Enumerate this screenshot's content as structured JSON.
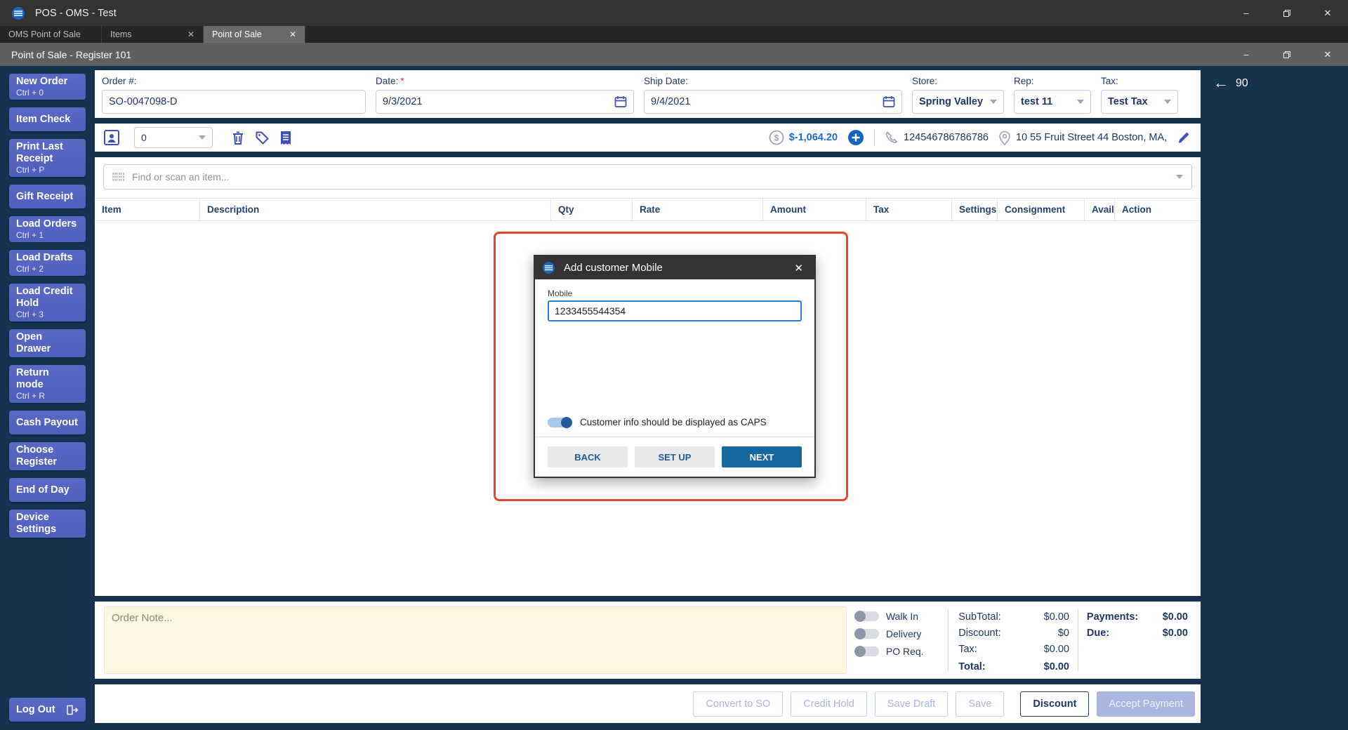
{
  "window": {
    "title": "POS - OMS - Test",
    "register_title": "Point of Sale - Register 101",
    "minimize": "–",
    "close": "✕"
  },
  "tabs": [
    {
      "label": "OMS Point of Sale"
    },
    {
      "label": "Items",
      "close": "✕"
    },
    {
      "label": "Point of Sale",
      "close": "✕"
    }
  ],
  "sidebar": {
    "items": [
      {
        "label": "New Order",
        "shortcut": "Ctrl + 0"
      },
      {
        "label": "Item Check"
      },
      {
        "label": "Print Last Receipt",
        "shortcut": "Ctrl + P"
      },
      {
        "label": "Gift Receipt"
      },
      {
        "label": "Load Orders",
        "shortcut": "Ctrl + 1"
      },
      {
        "label": "Load Drafts",
        "shortcut": "Ctrl + 2"
      },
      {
        "label": "Load Credit Hold",
        "shortcut": "Ctrl + 3"
      },
      {
        "label": "Open Drawer"
      },
      {
        "label": "Return mode",
        "shortcut": "Ctrl + R"
      },
      {
        "label": "Cash Payout"
      },
      {
        "label": "Choose Register"
      },
      {
        "label": "End of Day"
      },
      {
        "label": "Device Settings"
      }
    ],
    "logout_label": "Log Out"
  },
  "order_form": {
    "order_label": "Order #:",
    "order_value": "SO-0047098-D",
    "date_label": "Date:",
    "required_mark": "*",
    "date_value": "9/3/2021",
    "ship_date_label": "Ship Date:",
    "ship_date_value": "9/4/2021",
    "store_label": "Store:",
    "store_value": "Spring Valley",
    "rep_label": "Rep:",
    "rep_value": "test 11",
    "tax_label": "Tax:",
    "tax_value": "Test Tax"
  },
  "customer_bar": {
    "count_value": "0",
    "balance": "$-1,064.20",
    "phone": "124546786786786",
    "address": "10 55 Fruit Street 44 Boston, MA,..."
  },
  "back_nav": {
    "arrow": "←",
    "count": "90"
  },
  "search": {
    "placeholder": "Find or scan an item..."
  },
  "items_table": {
    "columns": [
      "Item",
      "Description",
      "Qty",
      "Rate",
      "Amount",
      "Tax",
      "Settings",
      "Consignment",
      "Avail",
      "Action"
    ]
  },
  "modal": {
    "title": "Add customer Mobile",
    "close": "✕",
    "field_label": "Mobile",
    "field_value": "1233455544354",
    "toggle_label": "Customer info should be displayed as CAPS",
    "back_label": "BACK",
    "setup_label": "SET UP",
    "next_label": "NEXT"
  },
  "footer": {
    "note_placeholder": "Order Note...",
    "toggles": [
      {
        "label": "Walk In",
        "state": "off"
      },
      {
        "label": "Delivery",
        "state": "off"
      },
      {
        "label": "PO Req.",
        "state": "off"
      }
    ],
    "totals": [
      {
        "label": "SubTotal:",
        "value": "$0.00"
      },
      {
        "label": "Discount:",
        "value": "$0"
      },
      {
        "label": "Tax:",
        "value": "$0.00"
      },
      {
        "label": "Total:",
        "value": "$0.00"
      }
    ],
    "payments": [
      {
        "label": "Payments:",
        "value": "$0.00"
      },
      {
        "label": "Due:",
        "value": "$0.00"
      }
    ],
    "buttons": [
      {
        "label": "Convert to SO"
      },
      {
        "label": "Credit Hold"
      },
      {
        "label": "Save Draft"
      },
      {
        "label": "Save"
      },
      {
        "label": "Discount"
      },
      {
        "label": "Accept Payment"
      }
    ]
  },
  "colors": {
    "app_background": "#16324f",
    "sidebar_button": "#5565c0",
    "accent_indigo": "#3f51b5",
    "link_blue": "#1a6fc4",
    "modal_blue": "#15679f",
    "highlight_red": "#e8432d",
    "note_yellow": "#fcf8e2",
    "text_navy": "#1f3864"
  }
}
